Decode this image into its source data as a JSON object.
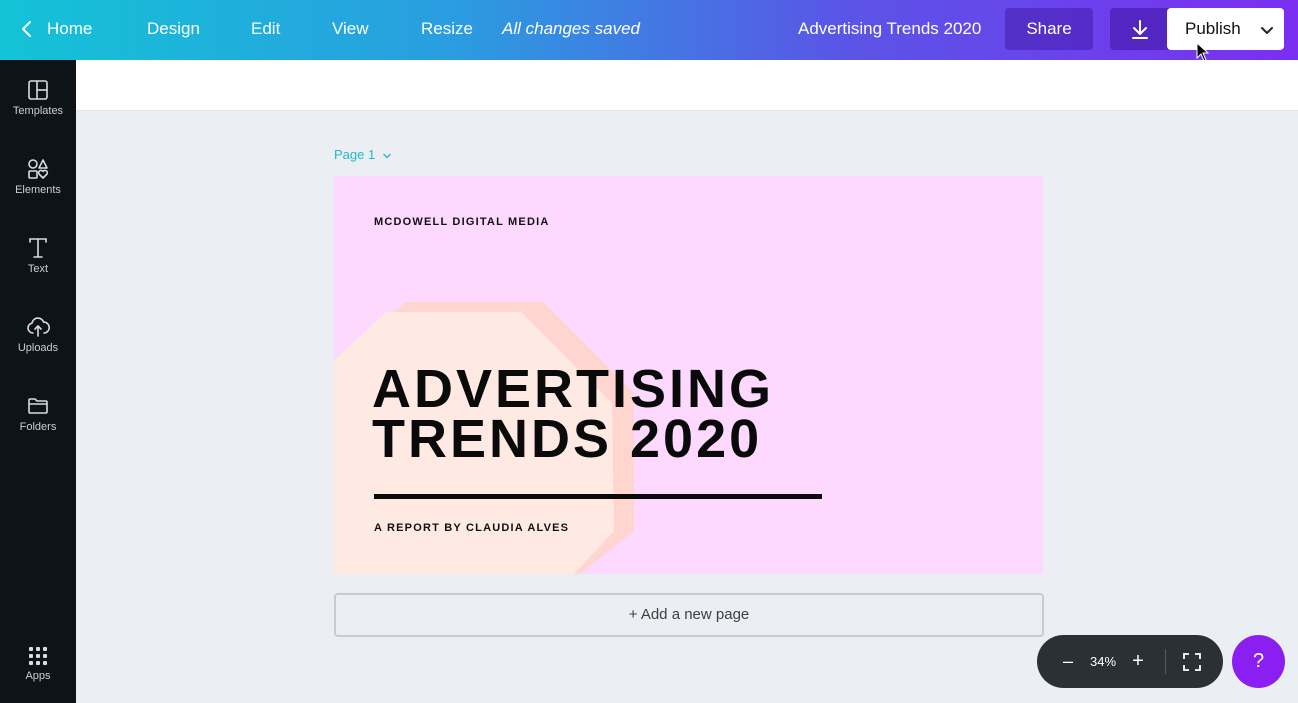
{
  "topbar": {
    "home": "Home",
    "design": "Design",
    "edit": "Edit",
    "view": "View",
    "resize": "Resize",
    "saved_status": "All changes saved",
    "doc_title": "Advertising Trends 2020",
    "share": "Share",
    "publish": "Publish",
    "icons": [
      "chevron-left-icon",
      "download-icon",
      "chevron-down-icon"
    ]
  },
  "sidebar": {
    "items": [
      {
        "label": "Templates",
        "icon": "templates-icon"
      },
      {
        "label": "Elements",
        "icon": "elements-icon"
      },
      {
        "label": "Text",
        "icon": "text-icon"
      },
      {
        "label": "Uploads",
        "icon": "upload-cloud-icon"
      },
      {
        "label": "Folders",
        "icon": "folder-icon"
      }
    ],
    "apps": {
      "label": "Apps",
      "icon": "apps-grid-icon"
    }
  },
  "page": {
    "label": "Page 1"
  },
  "design": {
    "brand": "MCDOWELL DIGITAL MEDIA",
    "headline_line1": "ADVERTISING",
    "headline_line2": "TRENDS 2020",
    "byline": "A REPORT BY CLAUDIA ALVES",
    "colors": {
      "background": "#fdd9ff",
      "shape_back": "#ffd5d0",
      "shape_front": "#ffeae3",
      "text": "#0a0a0a"
    }
  },
  "add_page": "+ Add a new page",
  "zoom": {
    "minus": "–",
    "level": "34%",
    "plus": "+"
  },
  "help": "?",
  "colors": {
    "accent_teal": "#13c3d6",
    "accent_purple": "#7b2ff0",
    "help_button": "#8b1ef0",
    "sidebar": "#0e1318"
  }
}
